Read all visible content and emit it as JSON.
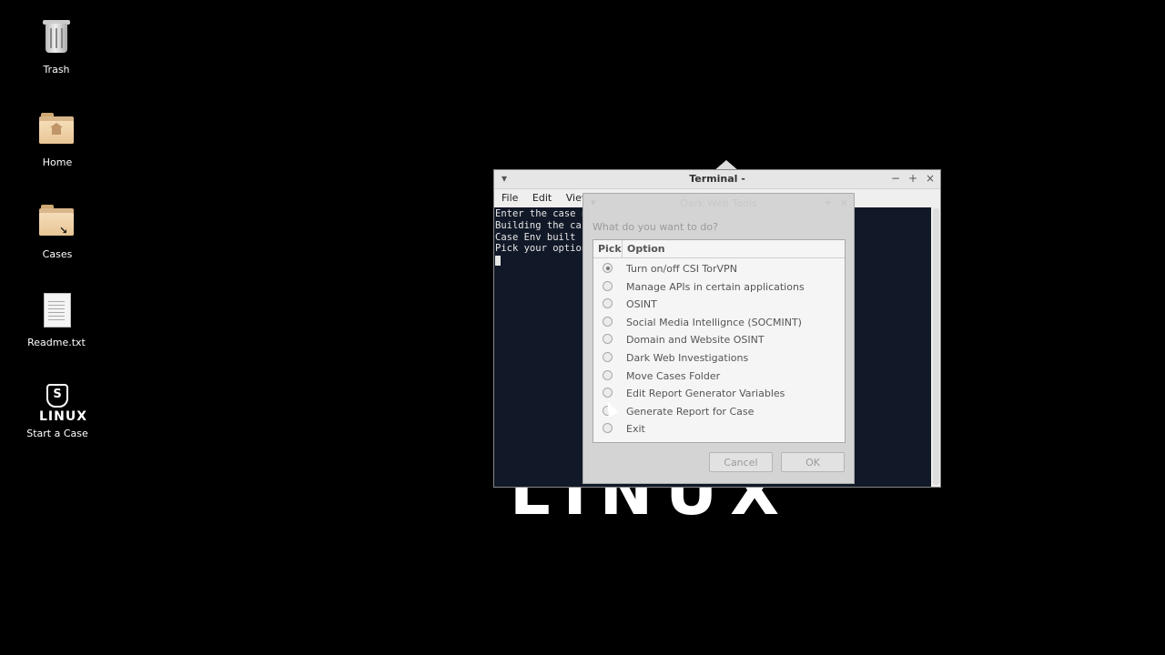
{
  "desktop": {
    "icons": [
      {
        "label": "Trash",
        "icon": "trash-icon"
      },
      {
        "label": "Home",
        "icon": "home-folder-icon"
      },
      {
        "label": "Cases",
        "icon": "folder-link-icon"
      },
      {
        "label": "Readme.txt",
        "icon": "text-file-icon"
      },
      {
        "label": "Start a Case",
        "icon": "csi-linux-logo-icon",
        "logo_text": "LINUX"
      }
    ],
    "wallpaper_text": "LINUX"
  },
  "terminal": {
    "title": "Terminal -",
    "menu": [
      "File",
      "Edit",
      "View"
    ],
    "lines": [
      "Enter the case n",
      "Building the cas",
      "Case Env built",
      "Pick your option"
    ]
  },
  "dialog": {
    "title": "Dark Web Tools",
    "prompt": "What do you want to do?",
    "columns": {
      "pick": "Pick",
      "option": "Option"
    },
    "options": [
      {
        "label": "Turn on/off CSI TorVPN",
        "checked": true
      },
      {
        "label": "Manage APIs in certain applications",
        "checked": false
      },
      {
        "label": "OSINT",
        "checked": false
      },
      {
        "label": "Social Media Intellignce (SOCMINT)",
        "checked": false
      },
      {
        "label": "Domain and Website OSINT",
        "checked": false
      },
      {
        "label": "Dark Web Investigations",
        "checked": false
      },
      {
        "label": "Move Cases Folder",
        "checked": false
      },
      {
        "label": "Edit Report Generator Variables",
        "checked": false
      },
      {
        "label": "Generate Report for Case",
        "checked": false
      },
      {
        "label": "Exit",
        "checked": false
      }
    ],
    "buttons": {
      "cancel": "Cancel",
      "ok": "OK"
    }
  }
}
